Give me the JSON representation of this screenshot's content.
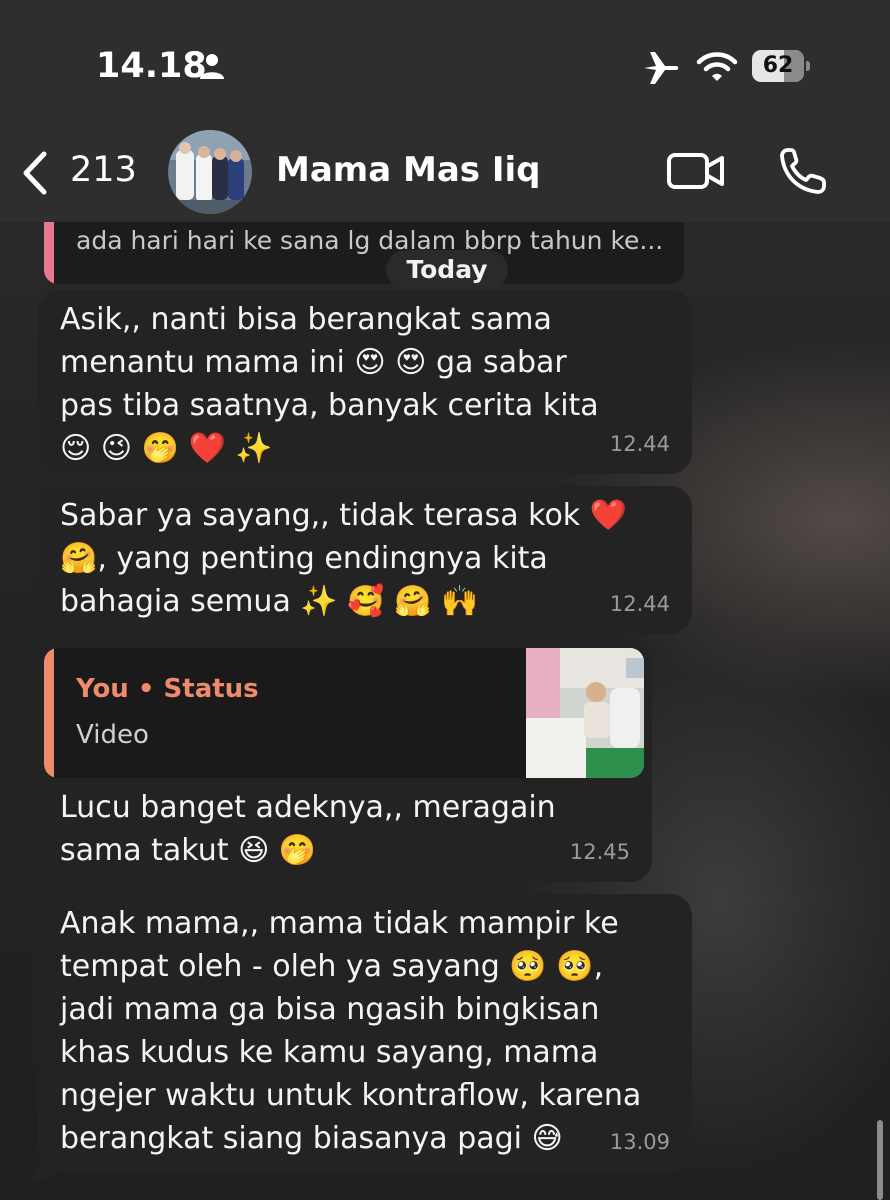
{
  "status_bar": {
    "time": "14.18",
    "battery": "62",
    "battery_level": 0.62,
    "icons": [
      "person-icon",
      "airplane-icon",
      "wifi-icon",
      "battery-icon"
    ]
  },
  "header": {
    "back_count": "213",
    "contact_name": "Mama Mas Iiq",
    "icons": [
      "chevron-left-icon",
      "video-call-icon",
      "phone-icon"
    ]
  },
  "chat": {
    "quoted_preview": "ada hari hari ke sana lg dalam bbrp tahun ke...",
    "date_chip": "Today",
    "messages": [
      {
        "text": "Asik,, nanti bisa berangkat sama menantu mama ini 😍 😍 ga sabar pas tiba saatnya, banyak cerita kita 😌 😉 🤭 ❤️ ✨",
        "time": "12.44"
      },
      {
        "text": "Sabar ya sayang,, tidak terasa kok ❤️ 🤗, yang penting endingnya kita bahagia semua ✨ 🥰 🤗 🙌",
        "time": "12.44"
      },
      {
        "reply": {
          "title": "You • Status",
          "subtitle": "Video"
        },
        "text": "Lucu banget adeknya,, meragain sama takut 😆 🤭",
        "time": "12.45"
      },
      {
        "text": "Anak mama,, mama tidak mampir ke tempat oleh - oleh ya sayang 🥺 🥺, jadi mama ga bisa ngasih bingkisan khas kudus ke kamu sayang, mama ngejer waktu untuk kontraflow, karena berangkat siang biasanya pagi 😅",
        "time": "13.09"
      }
    ]
  },
  "colors": {
    "bubble": "#232323",
    "quote_accent": "#e8788f",
    "status_accent": "#ef8a6d"
  }
}
